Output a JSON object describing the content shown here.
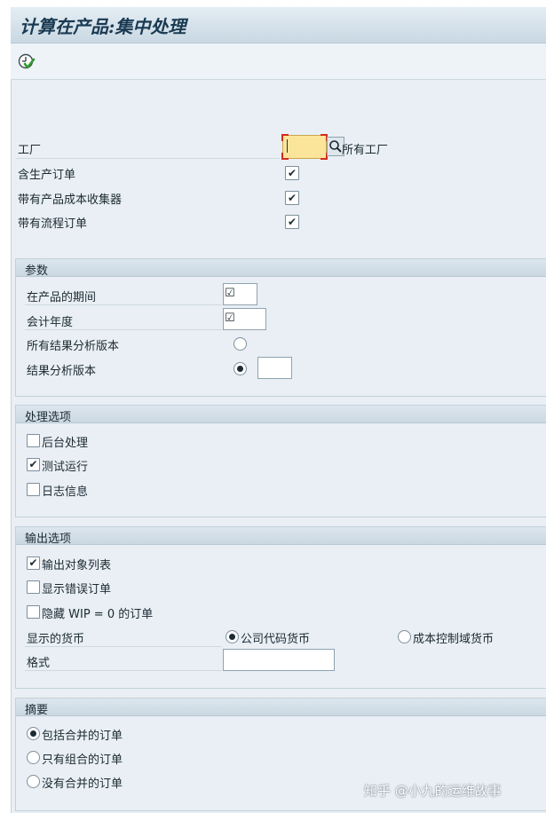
{
  "window": {
    "title": "计算在产品:集中处理"
  },
  "toolbar": {
    "execute_icon": "execute-clock-check-icon"
  },
  "selection": {
    "plant_label": "工厂",
    "plant_value": "",
    "all_plants_label": "所有工厂",
    "incl_production_orders_label": "含生产订单",
    "incl_production_orders_checked": true,
    "with_cost_collectors_label": "带有产品成本收集器",
    "with_cost_collectors_checked": true,
    "with_process_orders_label": "带有流程订单",
    "with_process_orders_checked": true
  },
  "params": {
    "title": "参数",
    "wip_period_label": "在产品的期间",
    "wip_period_value": "☑",
    "fiscal_year_label": "会计年度",
    "fiscal_year_value": "☑",
    "all_ra_versions_label": "所有结果分析版本",
    "ra_version_label": "结果分析版本",
    "ra_version_value": "",
    "selected_option": "结果分析版本"
  },
  "processing": {
    "title": "处理选项",
    "background_label": "后台处理",
    "background_checked": false,
    "test_run_label": "测试运行",
    "test_run_checked": true,
    "log_label": "日志信息",
    "log_checked": false
  },
  "output": {
    "title": "输出选项",
    "object_list_label": "输出对象列表",
    "object_list_checked": true,
    "show_error_orders_label": "显示错误订单",
    "show_error_orders_checked": false,
    "hide_wip0_label": "隐藏 WIP = 0 的订单",
    "hide_wip0_checked": false,
    "currency_label": "显示的货币",
    "currency_company_code_label": "公司代码货币",
    "currency_controlling_area_label": "成本控制域货币",
    "currency_selected": "公司代码货币",
    "layout_label": "格式",
    "layout_value": ""
  },
  "summary": {
    "title": "摘要",
    "incl_merged_label": "包括合并的订单",
    "only_combined_label": "只有组合的订单",
    "no_merged_label": "没有合并的订单",
    "selected": "包括合并的订单"
  },
  "watermark": "知乎 @小九的运维故事"
}
